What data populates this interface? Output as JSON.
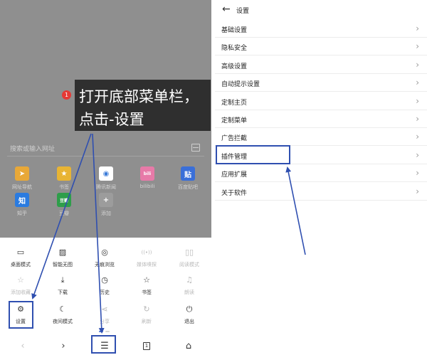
{
  "left": {
    "search_placeholder": "搜索或输入网址",
    "quick_links": [
      {
        "label": "网址导航",
        "glyph": "➤",
        "color": "#e8a838",
        "icon": "navigation-arrow-icon"
      },
      {
        "label": "书签",
        "glyph": "★",
        "color": "#e8b434",
        "icon": "star-icon"
      },
      {
        "label": "腾讯新闻",
        "glyph": "◉",
        "color": "#ffffff",
        "icon": "tencent-news-icon"
      },
      {
        "label": "bilibili",
        "glyph": "bili",
        "color": "#e77aa8",
        "icon": "bilibili-icon"
      },
      {
        "label": "百度贴吧",
        "glyph": "贴",
        "color": "#3a6fd8",
        "icon": "tieba-icon"
      },
      {
        "label": "知乎",
        "glyph": "知",
        "color": "#2a7be0",
        "icon": "zhihu-icon"
      },
      {
        "label": "豆瓣",
        "glyph": "豆瓣",
        "color": "#2e9e4a",
        "icon": "douban-icon"
      },
      {
        "label": "添加",
        "glyph": "+",
        "color": "#9c9c9c",
        "icon": "plus-icon"
      }
    ],
    "tip": {
      "badge": "1",
      "line1": "打开底部菜单栏，",
      "line2": "点击-设置"
    },
    "menu": [
      {
        "label": "桌面模式",
        "glyph": "▭",
        "icon": "desktop-icon",
        "disabled": false
      },
      {
        "label": "智能无图",
        "glyph": "▨",
        "icon": "no-image-icon",
        "disabled": false
      },
      {
        "label": "无痕浏览",
        "glyph": "◎",
        "icon": "incognito-eye-icon",
        "disabled": false
      },
      {
        "label": "媒体嗅探",
        "glyph": "((•))",
        "icon": "media-sniff-icon",
        "disabled": true
      },
      {
        "label": "阅读模式",
        "glyph": "▯▯",
        "icon": "reading-mode-icon",
        "disabled": true
      },
      {
        "label": "添加收藏",
        "glyph": "☆",
        "icon": "star-outline-icon",
        "disabled": true
      },
      {
        "label": "下载",
        "glyph": "⤓",
        "icon": "download-icon",
        "disabled": false
      },
      {
        "label": "历史",
        "glyph": "◷",
        "icon": "history-clock-icon",
        "disabled": false
      },
      {
        "label": "书签",
        "glyph": "☆",
        "icon": "bookmark-star-icon",
        "disabled": false
      },
      {
        "label": "朗读",
        "glyph": "♫",
        "icon": "headphones-icon",
        "disabled": true
      },
      {
        "label": "设置",
        "glyph": "⚙",
        "icon": "gear-icon",
        "disabled": false
      },
      {
        "label": "夜间模式",
        "glyph": "☾",
        "icon": "moon-icon",
        "disabled": false
      },
      {
        "label": "分享",
        "glyph": "⋖",
        "icon": "share-icon",
        "disabled": true
      },
      {
        "label": "刷新",
        "glyph": "↻",
        "icon": "refresh-icon",
        "disabled": true
      },
      {
        "label": "退出",
        "glyph": "⏻",
        "icon": "power-icon",
        "disabled": false
      }
    ],
    "nav": {
      "back": "‹",
      "forward": "›",
      "menu": "☰",
      "tabs": "1",
      "home": "⌂"
    }
  },
  "right": {
    "title": "设置",
    "back": "←",
    "items": [
      "基础设置",
      "隐私安全",
      "高级设置",
      "自动提示设置",
      "定制主页",
      "定制菜单",
      "广告拦截",
      "插件管理",
      "应用扩展",
      "关于软件"
    ]
  },
  "colors": {
    "highlight": "#2f4fb0",
    "badge": "#e53935",
    "dim_overlay": "#8f8f8f",
    "tip_bg": "#2f2f2f"
  }
}
